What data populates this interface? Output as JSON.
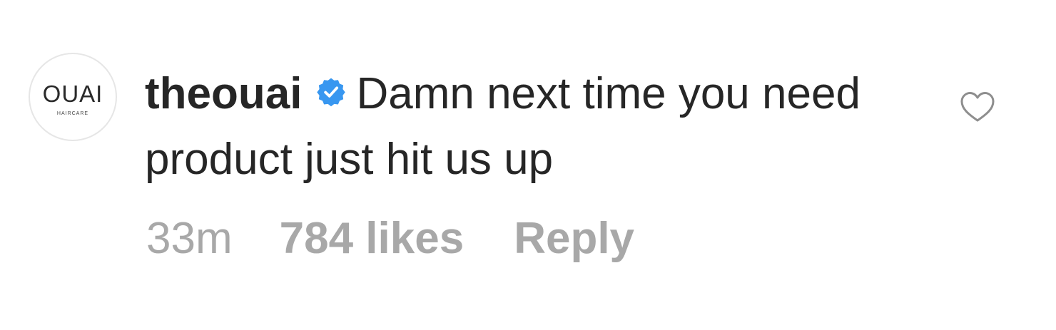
{
  "comment": {
    "avatar": {
      "logo_text": "OUAI",
      "sub_text": "HAIRCARE"
    },
    "username": "theouai",
    "verified": true,
    "text": "Damn next time you need product just hit us up",
    "time": "33m",
    "likes_label": "784 likes",
    "reply_label": "Reply",
    "like_icon": "heart-outline-icon",
    "verified_icon": "verified-badge-icon"
  },
  "colors": {
    "text": "#262626",
    "meta": "#a8a8a8",
    "verified_blue": "#3897f0",
    "heart_stroke": "#8e8e8e"
  }
}
